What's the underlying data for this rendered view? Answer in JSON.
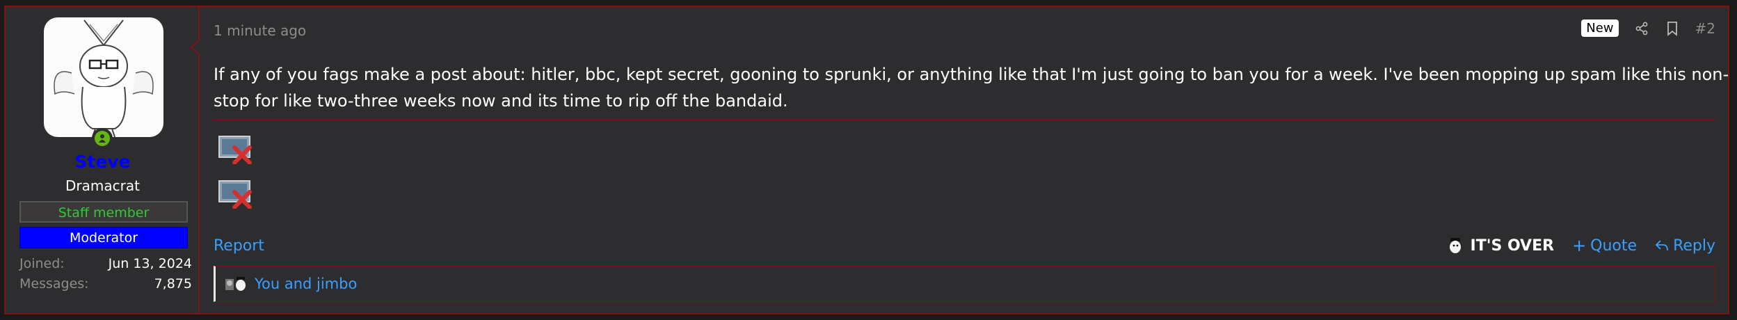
{
  "user": {
    "name": "Steve",
    "title": "Dramacrat",
    "banners": [
      "Staff member",
      "Moderator"
    ],
    "stats": [
      {
        "label": "Joined:",
        "value": "Jun 13, 2024"
      },
      {
        "label": "Messages:",
        "value": "7,875"
      }
    ],
    "online": true
  },
  "post": {
    "timestamp": "1 minute ago",
    "new_badge": "New",
    "number": "#2",
    "message": "If any of you fags make a post about: hitler, bbc, kept secret, gooning to sprunki, or anything like that I'm just going to ban you for a week. I've been mopping up spam like this non-stop for like two-three weeks now and its time to rip off the bandaid."
  },
  "footer": {
    "report": "Report",
    "reaction_label": "IT'S OVER",
    "quote": "Quote",
    "reply": "Reply"
  },
  "reactions": {
    "text": "You and jimbo"
  },
  "icons": {
    "share": "share-icon",
    "bookmark": "bookmark-icon",
    "quote": "plus-icon",
    "reply": "reply-icon",
    "broken_image": "broken-image-icon"
  },
  "colors": {
    "accent_red": "#7c1414",
    "link_blue": "#3aa0ff",
    "username_blue": "#0000ff",
    "staff_green": "#2ecc2e",
    "online_green": "#63b515",
    "background": "#2d2c2e"
  }
}
